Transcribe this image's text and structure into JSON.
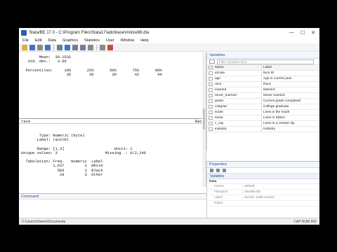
{
  "window": {
    "title": "Stata/BE 17.0 - C:\\Program Files\\Stata17\\ado\\base\\n\\nlsw88.dta",
    "controls": [
      "—",
      "☐",
      "✕"
    ]
  },
  "menu": [
    "File",
    "Edit",
    "Data",
    "Graphics",
    "Statistics",
    "User",
    "Window",
    "Help"
  ],
  "results": {
    "top_stats": "        Mean:  39.1532\n   Std. dev.:   3.06\n\n  Percentiles:     10%       25%       50%       75%       90%\n                    35        36        39        42        44",
    "section_var": "race",
    "section_right": "Race",
    "body": "        Type: Numeric (byte)\n       Label: racelbl\n\n       Range: [1,3]                      Units: 1\nUnique values: 3                     Missing .: 0/2,246\n\n  Tabulation: Freq.   Numeric  Label\n              1,637         1  White\n                583         2  Black\n                 26         3  Other"
  },
  "command": {
    "title": "Command"
  },
  "status": {
    "path": "C:\\Users\\Owner\\Documents",
    "right": "CAP   NUM   INS"
  },
  "variables": {
    "title": "Variables",
    "filter_placeholder": "Filter variables here",
    "col_name": "Name",
    "col_label": "Label",
    "rows": [
      {
        "name": "idcode",
        "label": "NLS ID"
      },
      {
        "name": "age",
        "label": "Age in current year"
      },
      {
        "name": "race",
        "label": "Race"
      },
      {
        "name": "married",
        "label": "Married"
      },
      {
        "name": "never_married",
        "label": "Never married"
      },
      {
        "name": "grade",
        "label": "Current grade completed"
      },
      {
        "name": "collgrad",
        "label": "College graduate"
      },
      {
        "name": "south",
        "label": "Lives in the south"
      },
      {
        "name": "smsa",
        "label": "Lives in SMSA"
      },
      {
        "name": "c_city",
        "label": "Lives in a central city"
      },
      {
        "name": "industry",
        "label": "Industry"
      }
    ]
  },
  "properties": {
    "title": "Properties",
    "section": "Variables",
    "subsection": "Data",
    "rows": [
      {
        "key": "Frame",
        "value": "default"
      },
      {
        "key": "Filename",
        "value": "nlsw88.dta"
      },
      {
        "key": "Label",
        "value": "NLSW, 1988 extract"
      },
      {
        "key": "Notes",
        "value": ""
      }
    ]
  }
}
